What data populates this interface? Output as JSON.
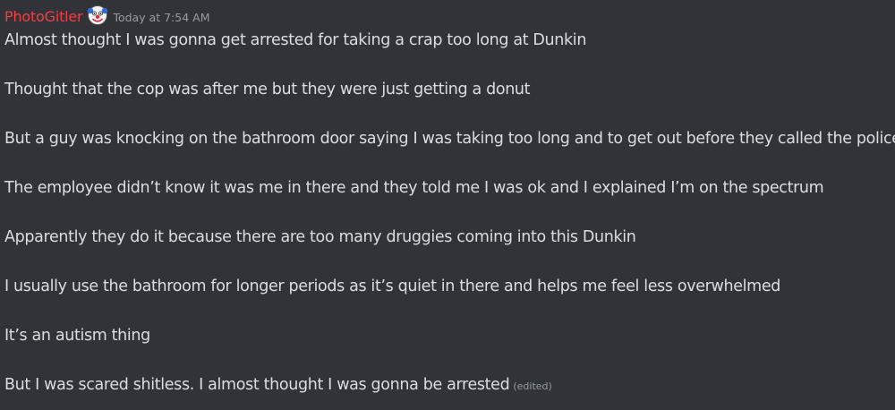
{
  "message": {
    "username": "PhotoGitler",
    "badge_icon": "clown-face-emoji-icon",
    "username_color": "#f23f43",
    "timestamp": "Today at 7:54 AM",
    "lines": [
      "Almost thought I was gonna get arrested for taking a crap too long at Dunkin",
      "Thought that the cop was after me but they were just getting a donut",
      "But a guy was knocking on the bathroom door saying I was taking too long and to get out before they called the police",
      "The employee didn’t know it was me in there and they told me I was ok and I explained I’m on the spectrum",
      "Apparently they do it because there are too many druggies coming into this Dunkin",
      "I usually use the bathroom for longer periods as it’s quiet in there and helps me feel less overwhelmed",
      "It’s an autism thing",
      "But I was scared shitless. I almost thought I was gonna be arrested"
    ],
    "edited_label": "(edited)"
  }
}
